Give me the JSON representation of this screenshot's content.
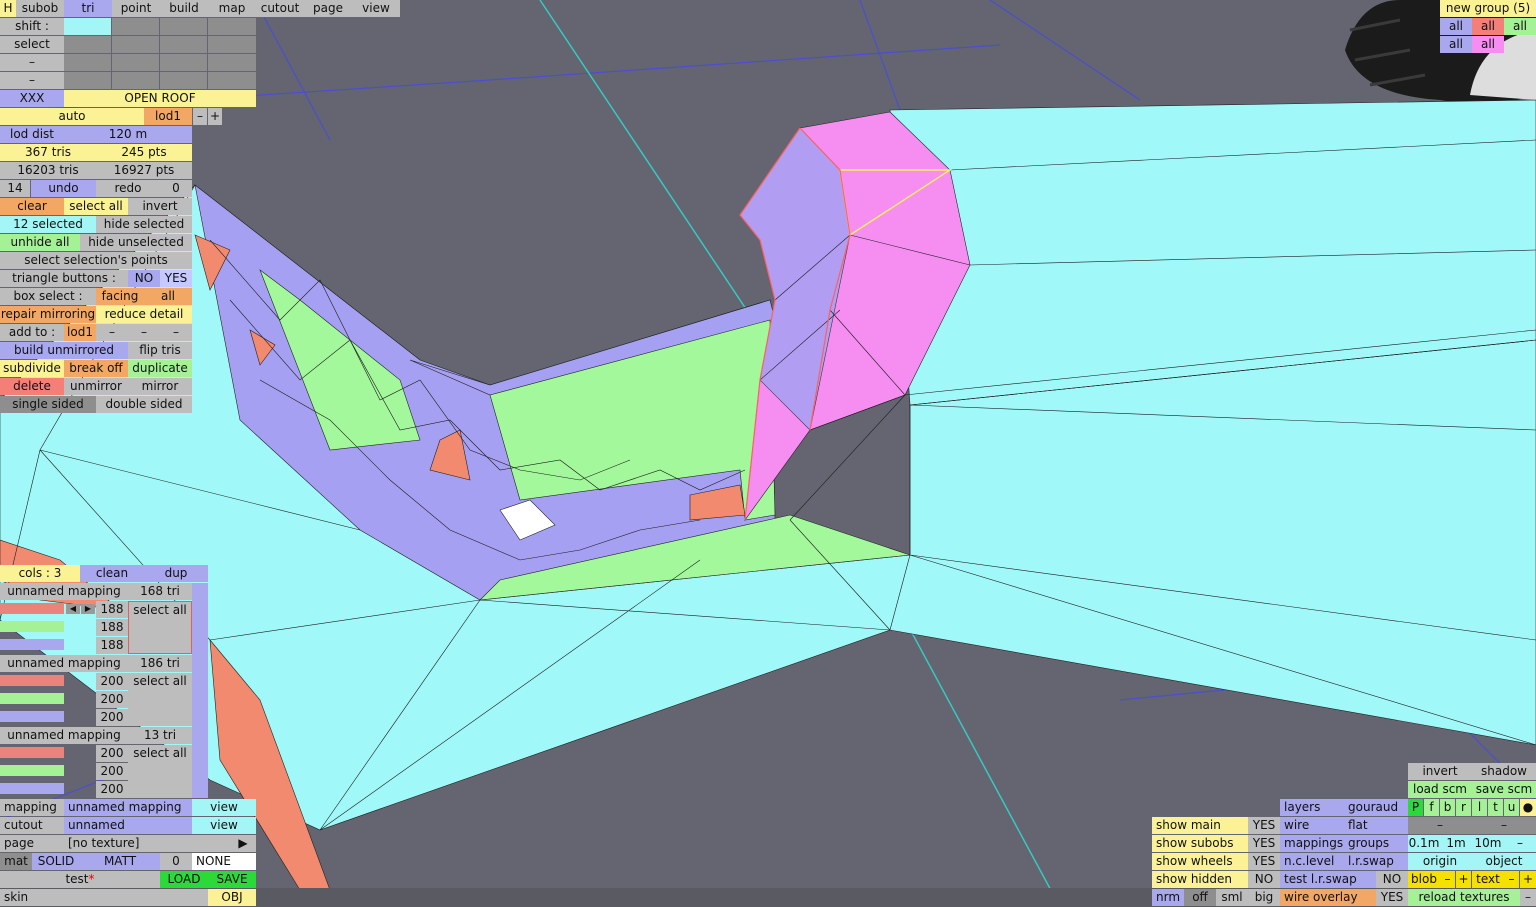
{
  "menu": {
    "h": "H",
    "tabs": [
      "subob",
      "tri",
      "point",
      "build",
      "map",
      "cutout",
      "page",
      "view"
    ]
  },
  "rows": {
    "shift": "shift :",
    "select": "select",
    "dash": "–"
  },
  "subob": {
    "xxx": "XXX",
    "name": "OPEN ROOF",
    "auto": "auto",
    "lod": "lod1",
    "minus": "–",
    "plus": "+"
  },
  "lod": {
    "label": "lod dist",
    "value": "120 m"
  },
  "stats": {
    "tris": "367 tris",
    "pts": "245 pts",
    "total_tris": "16203 tris",
    "total_pts": "16927 pts"
  },
  "history": {
    "count": "14",
    "undo": "undo",
    "redo": "redo",
    "redo_count": "0"
  },
  "actions": {
    "clear": "clear",
    "select_all": "select all",
    "invert": "invert",
    "selected": "12 selected",
    "hide_selected": "hide selected",
    "unhide_all": "unhide all",
    "hide_unselected": "hide unselected",
    "select_points": "select selection's points",
    "tri_buttons": "triangle buttons :",
    "no": "NO",
    "yes": "YES",
    "box_select": "box select :",
    "facing": "facing",
    "all": "all",
    "repair": "repair mirroring",
    "reduce": "reduce detail",
    "add_to": "add to :",
    "add_lod": "lod1",
    "build_unmirrored": "build unmirrored",
    "flip": "flip tris",
    "subdivide": "subdivide",
    "break_off": "break off",
    "duplicate": "duplicate",
    "delete": "delete",
    "unmirror": "unmirror",
    "mirror": "mirror",
    "single": "single sided",
    "double": "double sided"
  },
  "cols": {
    "label": "cols : 3",
    "clean": "clean",
    "dup": "dup"
  },
  "mappings": [
    {
      "name": "unnamed mapping",
      "tris": "168 tri",
      "values": [
        "188",
        "188",
        "188"
      ],
      "select_all": "select all"
    },
    {
      "name": "unnamed mapping",
      "tris": "186 tri",
      "values": [
        "200",
        "200",
        "200"
      ],
      "select_all": "select all"
    },
    {
      "name": "unnamed mapping",
      "tris": "13 tri",
      "values": [
        "200",
        "200",
        "200"
      ],
      "select_all": "select all"
    }
  ],
  "bottom_left": {
    "mapping": "mapping",
    "mapping_val": "unnamed mapping",
    "view": "view",
    "cutout": "cutout",
    "cutout_val": "unnamed",
    "page": "page",
    "texture": "[no texture]",
    "arrow": "▶",
    "mat": "mat",
    "solid": "SOLID",
    "matt": "MATT",
    "zero": "0",
    "none": "NONE",
    "test": "test",
    "star": "*",
    "load": "LOAD",
    "save": "SAVE",
    "skin": "skin",
    "obj": "OBJ"
  },
  "groups": {
    "title": "new group (5)",
    "all": "all"
  },
  "right": {
    "invert": "invert",
    "shadow": "shadow",
    "load_scm": "load scm",
    "save_scm": "save scm",
    "letters": [
      "P",
      "f",
      "b",
      "r",
      "l",
      "t",
      "u"
    ],
    "dot": "●",
    "layers": "layers",
    "gouraud": "gouraud",
    "wire": "wire",
    "flat": "flat",
    "mappings": "mappings",
    "groups": "groups",
    "m01": "0.1m",
    "m1": "1m",
    "m10": "10m",
    "minus": "–",
    "plus": "+",
    "nclevel": "n.c.level",
    "lrswap": "l.r.swap",
    "origin": "origin",
    "object": "object",
    "test_lrswap": "test l.r.swap",
    "no": "NO",
    "yes": "YES",
    "blob": "blob",
    "text": "text",
    "wire_overlay": "wire overlay",
    "reload": "reload textures",
    "show_main": "show main",
    "show_subobs": "show subobs",
    "show_wheels": "show wheels",
    "show_hidden": "show hidden",
    "nrm": "nrm",
    "off": "off",
    "sml": "sml",
    "big": "big"
  },
  "colors": {
    "background": "#646570",
    "cyan_mesh": "#a0f8f8",
    "pink_mesh": "#f68ef2",
    "lavender_mesh": "#a6a0f2",
    "green_mesh": "#a2f89a",
    "salmon_mesh": "#f28a70",
    "grid": "#4b4ed2"
  }
}
